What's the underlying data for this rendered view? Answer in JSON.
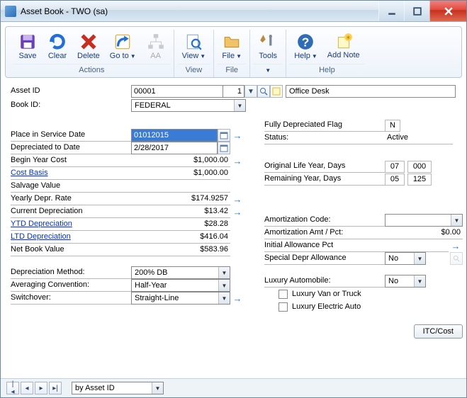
{
  "window": {
    "title": "Asset Book  -  TWO (sa)"
  },
  "toolbar": {
    "save": "Save",
    "clear": "Clear",
    "delete": "Delete",
    "goto": "Go to",
    "aa": "AA",
    "view": "View",
    "file": "File",
    "tools": "Tools",
    "help": "Help",
    "addnote": "Add Note",
    "group_actions": "Actions",
    "group_view": "View",
    "group_file": "File",
    "group_help": "Help"
  },
  "header": {
    "asset_id_label": "Asset ID",
    "asset_id": "00001",
    "asset_suffix": "1",
    "asset_desc": "Office Desk",
    "book_id_label": "Book ID:",
    "book_id": "FEDERAL"
  },
  "left": {
    "place_service_label": "Place in Service Date",
    "place_service": "01012015",
    "depr_to_label": "Depreciated to Date",
    "depr_to": "2/28/2017",
    "begin_year_cost_label": "Begin Year Cost",
    "begin_year_cost": "$1,000.00",
    "cost_basis_label": "Cost Basis",
    "cost_basis": "$1,000.00",
    "salvage_label": "Salvage Value",
    "salvage": "",
    "yearly_rate_label": "Yearly Depr. Rate",
    "yearly_rate": "$174.9257",
    "current_depr_label": "Current Depreciation",
    "current_depr": "$13.42",
    "ytd_label": "YTD Depreciation",
    "ytd": "$28.28",
    "ltd_label": "LTD Depreciation",
    "ltd": "$416.04",
    "net_book_label": "Net Book Value",
    "net_book": "$583.96",
    "depr_method_label": "Depreciation Method:",
    "depr_method": "200% DB",
    "avg_conv_label": "Averaging Convention:",
    "avg_conv": "Half-Year",
    "switchover_label": "Switchover:",
    "switchover": "Straight-Line"
  },
  "right": {
    "fully_depr_label": "Fully Depreciated Flag",
    "fully_depr": "N",
    "status_label": "Status:",
    "status": "Active",
    "orig_life_label": "Original Life Year, Days",
    "orig_life_year": "07",
    "orig_life_days": "000",
    "remain_life_label": "Remaining Year, Days",
    "remain_life_year": "05",
    "remain_life_days": "125",
    "amort_code_label": "Amortization Code:",
    "amort_code": "",
    "amort_amt_label": "Amortization Amt / Pct:",
    "amort_amt": "$0.00",
    "init_allow_label": "Initial Allowance Pct",
    "init_allow": "",
    "spec_depr_label": "Special Depr Allowance",
    "spec_depr": "No",
    "lux_auto_label": "Luxury Automobile:",
    "lux_auto": "No",
    "lux_van_label": "Luxury Van or Truck",
    "lux_elec_label": "Luxury Electric Auto",
    "itc_cost": "ITC/Cost"
  },
  "footer": {
    "sort_by": "by Asset ID"
  }
}
